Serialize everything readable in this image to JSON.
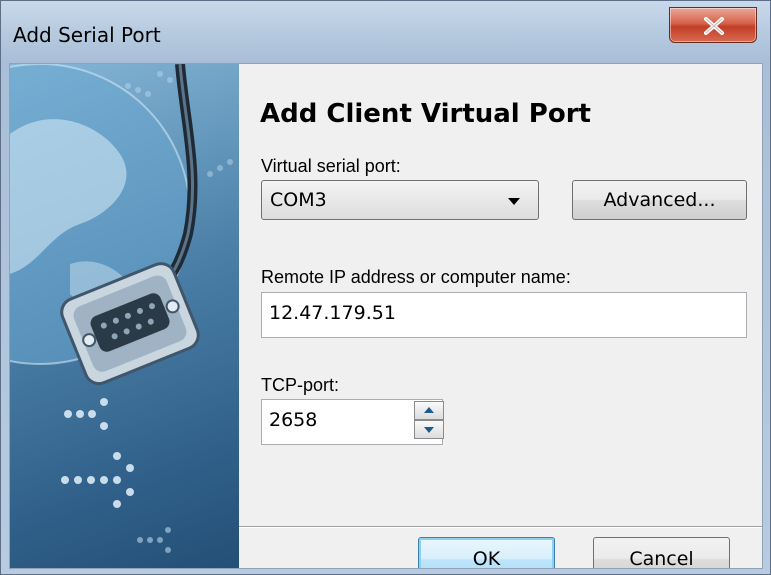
{
  "window": {
    "title": "Add Serial Port"
  },
  "dialog": {
    "heading": "Add Client Virtual Port",
    "virtual_port": {
      "label": "Virtual serial port:",
      "value": "COM3"
    },
    "advanced_label": "Advanced...",
    "remote": {
      "label": "Remote IP address or computer name:",
      "value": "12.47.179.51"
    },
    "tcp": {
      "label": "TCP-port:",
      "value": "2658"
    },
    "ok_label": "OK",
    "cancel_label": "Cancel"
  },
  "icons": {
    "close": "close-icon",
    "dropdown": "chevron-down-icon",
    "spin_up": "spin-up-icon",
    "spin_down": "spin-down-icon"
  },
  "colors": {
    "close_button": "#c94a32",
    "default_button_border": "#3c7fb1",
    "banner_blue": "#2f5f88"
  }
}
